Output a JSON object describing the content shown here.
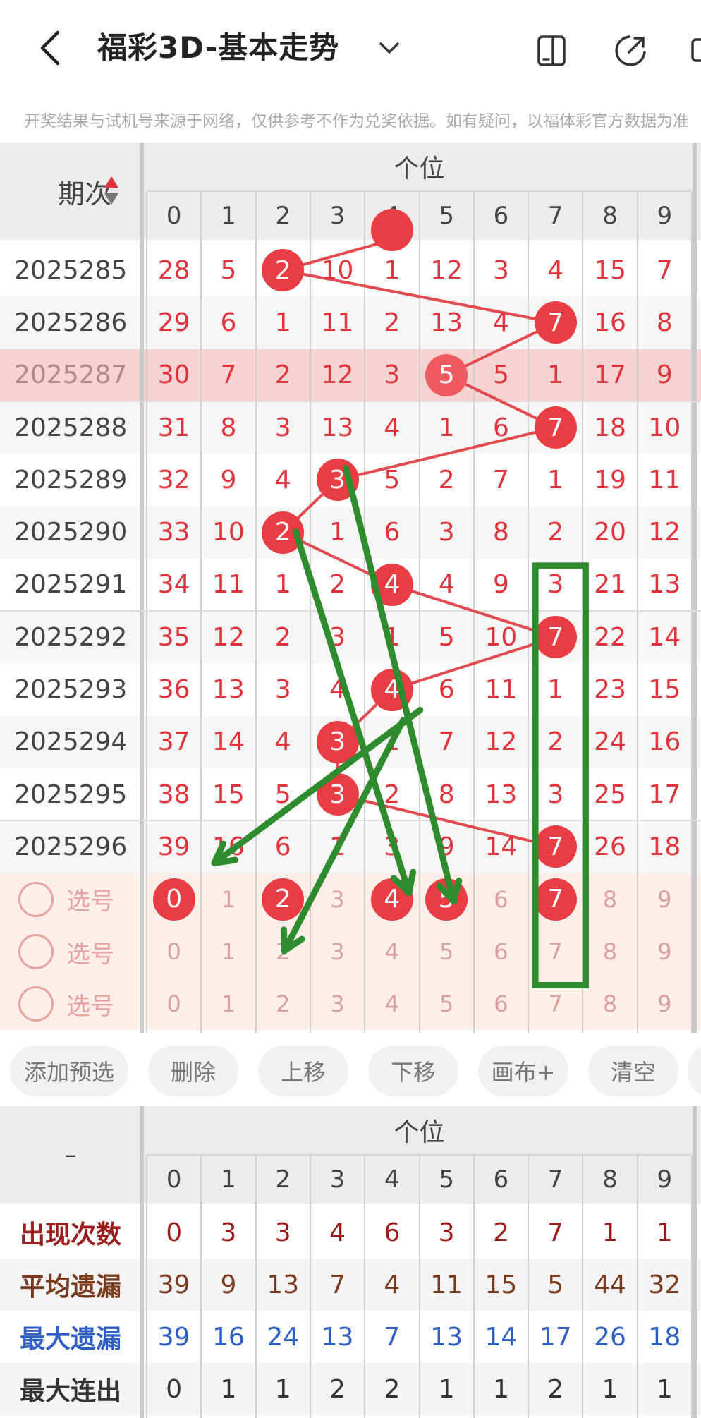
{
  "header": {
    "title": "福彩3D-基本走势",
    "notice": "开奖结果与试机号来源于网络，仅供参考不作为兑奖依据。如有疑问，以福体彩官方数据为准"
  },
  "table": {
    "period_header": "期次",
    "position_header": "个位",
    "digits": [
      "0",
      "1",
      "2",
      "3",
      "4",
      "5",
      "6",
      "7",
      "8",
      "9"
    ],
    "rows": [
      {
        "period": "2025285",
        "hit": 2,
        "values": [
          "28",
          "5",
          "2",
          "10",
          "1",
          "12",
          "3",
          "4",
          "15",
          "7"
        ]
      },
      {
        "period": "2025286",
        "hit": 7,
        "values": [
          "29",
          "6",
          "1",
          "11",
          "2",
          "13",
          "4",
          "7",
          "16",
          "8"
        ]
      },
      {
        "period": "2025287",
        "hit": 5,
        "values": [
          "30",
          "7",
          "2",
          "12",
          "3",
          "5",
          "5",
          "1",
          "17",
          "9"
        ]
      },
      {
        "period": "2025288",
        "hit": 7,
        "values": [
          "31",
          "8",
          "3",
          "13",
          "4",
          "1",
          "6",
          "7",
          "18",
          "10"
        ]
      },
      {
        "period": "2025289",
        "hit": 3,
        "values": [
          "32",
          "9",
          "4",
          "3",
          "5",
          "2",
          "7",
          "1",
          "19",
          "11"
        ]
      },
      {
        "period": "2025290",
        "hit": 2,
        "values": [
          "33",
          "10",
          "2",
          "1",
          "6",
          "3",
          "8",
          "2",
          "20",
          "12"
        ]
      },
      {
        "period": "2025291",
        "hit": 4,
        "values": [
          "34",
          "11",
          "1",
          "2",
          "4",
          "4",
          "9",
          "3",
          "21",
          "13"
        ]
      },
      {
        "period": "2025292",
        "hit": 7,
        "values": [
          "35",
          "12",
          "2",
          "3",
          "1",
          "5",
          "10",
          "7",
          "22",
          "14"
        ]
      },
      {
        "period": "2025293",
        "hit": 4,
        "values": [
          "36",
          "13",
          "3",
          "4",
          "4",
          "6",
          "11",
          "1",
          "23",
          "15"
        ]
      },
      {
        "period": "2025294",
        "hit": 3,
        "values": [
          "37",
          "14",
          "4",
          "3",
          "1",
          "7",
          "12",
          "2",
          "24",
          "16"
        ]
      },
      {
        "period": "2025295",
        "hit": 3,
        "values": [
          "38",
          "15",
          "5",
          "3",
          "2",
          "8",
          "13",
          "3",
          "25",
          "17"
        ]
      },
      {
        "period": "2025296",
        "hit": 7,
        "values": [
          "39",
          "16",
          "6",
          "1",
          "3",
          "9",
          "14",
          "7",
          "26",
          "18"
        ]
      }
    ],
    "selection_rows": [
      {
        "label": "选号",
        "selected": [
          0,
          2,
          4,
          5,
          7
        ]
      },
      {
        "label": "选号",
        "selected": []
      },
      {
        "label": "选号",
        "selected": []
      }
    ]
  },
  "buttons": [
    {
      "label": "添加预选"
    },
    {
      "label": "删除"
    },
    {
      "label": "上移"
    },
    {
      "label": "下移"
    },
    {
      "label": "画布+"
    },
    {
      "label": "清空"
    }
  ],
  "stats": {
    "dash": "–",
    "position_header": "个位",
    "digits": [
      "0",
      "1",
      "2",
      "3",
      "4",
      "5",
      "6",
      "7",
      "8",
      "9"
    ],
    "rows": [
      {
        "label": "出现次数",
        "color": "#9b1c1c",
        "values": [
          "0",
          "3",
          "3",
          "4",
          "6",
          "3",
          "2",
          "7",
          "1",
          "1"
        ]
      },
      {
        "label": "平均遗漏",
        "color": "#7a3a1c",
        "values": [
          "39",
          "9",
          "13",
          "7",
          "4",
          "11",
          "15",
          "5",
          "44",
          "32"
        ]
      },
      {
        "label": "最大遗漏",
        "color": "#2f5fc4",
        "values": [
          "39",
          "16",
          "24",
          "13",
          "7",
          "13",
          "14",
          "17",
          "26",
          "18"
        ]
      },
      {
        "label": "最大连出",
        "color": "#333333",
        "values": [
          "0",
          "1",
          "1",
          "2",
          "2",
          "1",
          "1",
          "2",
          "1",
          "1"
        ]
      }
    ]
  },
  "colors": {
    "accent_red": "#ea3c43",
    "annotation_green": "#2e8b2e",
    "highlight_row": "#f6d3d3",
    "selection_bg": "#fdeeea"
  }
}
